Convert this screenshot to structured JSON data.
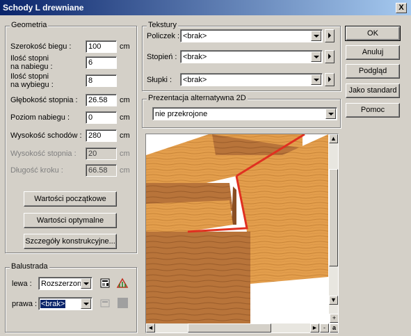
{
  "window": {
    "title": "Schody L drewniane",
    "close": "X"
  },
  "geometria": {
    "legend": "Geometria",
    "rows": [
      {
        "label": "Szerokość biegu :",
        "value": "100",
        "unit": "cm",
        "readonly": false
      },
      {
        "label": "Ilość stopni\nna nabiegu :",
        "value": "6",
        "unit": "",
        "readonly": false
      },
      {
        "label": "Ilość stopni\nna wybiegu :",
        "value": "8",
        "unit": "",
        "readonly": false
      },
      {
        "label": "Głębokość stopnia :",
        "value": "26.58",
        "unit": "cm",
        "readonly": false
      },
      {
        "label": "Poziom nabiegu :",
        "value": "0",
        "unit": "cm",
        "readonly": false
      },
      {
        "label": "Wysokość schodów :",
        "value": "280",
        "unit": "cm",
        "readonly": false
      },
      {
        "label": "Wysokość stopnia :",
        "value": "20",
        "unit": "cm",
        "readonly": true
      },
      {
        "label": "Długość kroku :",
        "value": "66.58",
        "unit": "cm",
        "readonly": true
      }
    ],
    "buttons": {
      "initial": "Wartości początkowe",
      "optimal": "Wartości optymalne",
      "details": "Szczegóły konstrukcyjne..."
    }
  },
  "balustrada": {
    "legend": "Balustrada",
    "left_label": "lewa :",
    "left_value": "Rozszerzona",
    "right_label": "prawa :",
    "right_value": "<brak>"
  },
  "tekstury": {
    "legend": "Tekstury",
    "rows": [
      {
        "label": "Policzek :",
        "value": "<brak>"
      },
      {
        "label": "Stopień :",
        "value": "<brak>"
      },
      {
        "label": "Słupki :",
        "value": "<brak>"
      }
    ]
  },
  "prezentacja": {
    "legend": "Prezentacja alternatywna 2D",
    "value": "nie przekrojone"
  },
  "side_buttons": {
    "ok": "OK",
    "cancel": "Anuluj",
    "preview": "Podgląd",
    "standard": "Jako standard",
    "help": "Pomoc"
  },
  "preview_scroll": {
    "plus": "+",
    "minus": "-",
    "a": "a"
  },
  "colors": {
    "wood_light": "#e7a24a",
    "wood_dark": "#b06a2a",
    "highlight_line": "#e03020",
    "selection": "#0a246a"
  }
}
